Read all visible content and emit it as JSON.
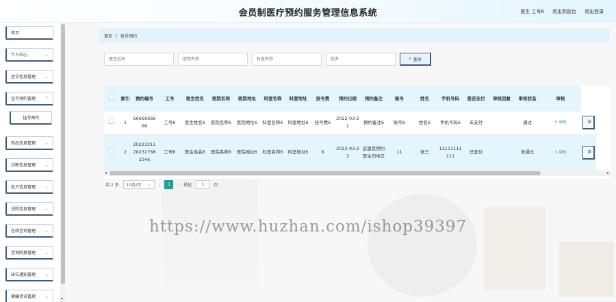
{
  "header": {
    "title": "会员制医疗预约服务管理信息系统",
    "user_label": "医生 工号6",
    "back_front": "退出到前台",
    "logout": "退出登录"
  },
  "sidebar": {
    "items": [
      {
        "label": "首页",
        "has_chevron": false
      },
      {
        "label": "个人中心",
        "has_chevron": true
      },
      {
        "label": "坐诊信息管理",
        "has_chevron": true
      },
      {
        "label": "挂号预约管理",
        "has_chevron": true
      },
      {
        "label": "挂号预约",
        "has_chevron": false
      },
      {
        "label": "药品信息管理",
        "has_chevron": true
      },
      {
        "label": "诊断信息管理",
        "has_chevron": true
      },
      {
        "label": "处方信息管理",
        "has_chevron": true
      },
      {
        "label": "住院信息管理",
        "has_chevron": true
      },
      {
        "label": "在线咨询管理",
        "has_chevron": true
      },
      {
        "label": "咨询回复管理",
        "has_chevron": true
      },
      {
        "label": "床位通知管理",
        "has_chevron": true
      },
      {
        "label": "健康资讯管理",
        "has_chevron": true
      }
    ]
  },
  "breadcrumb": {
    "home": "首页",
    "sep": "/",
    "current": "挂号预约"
  },
  "search": {
    "doctor_name_placeholder": "医生姓名",
    "hospital_name_placeholder": "医院名称",
    "department_name_placeholder": "科室名称",
    "name_placeholder": "姓名",
    "query_label": "查询"
  },
  "table": {
    "headers": [
      "索引",
      "预约编号",
      "工号",
      "医生姓名",
      "医院名称",
      "医院地址",
      "科室名称",
      "科室地址",
      "挂号费",
      "预约日期",
      "预约备注",
      "账号",
      "姓名",
      "手机号码",
      "是否支付",
      "审核回复",
      "审核状态",
      "审核"
    ],
    "rows": [
      {
        "cells": [
          "1",
          "6666666666",
          "工号6",
          "医生姓名6",
          "医院名称6",
          "医院地址6",
          "科室名称6",
          "科室地址6",
          "挂号费6",
          "2022-03-21",
          "预约备注6",
          "账号6",
          "姓名6",
          "手机号码6",
          "未支付",
          "",
          "通过",
          "审核"
        ],
        "action": "详"
      },
      {
        "cells": [
          "2",
          "20223211782327682346",
          "工号6",
          "医生姓名6",
          "医院名称6",
          "医院地址6",
          "科室名称6",
          "科室地址6",
          "6",
          "2022-03-23",
          "这里是预约医生的地方",
          "11",
          "张三",
          "13111111111",
          "已支付",
          "",
          "未通过",
          "审核"
        ],
        "action": "详"
      }
    ]
  },
  "pagination": {
    "total": "共 2 条",
    "page_size": "10条/页",
    "prev": "‹",
    "current_page": "1",
    "next": "›",
    "goto_label": "前往",
    "goto_value": "1",
    "page_unit": "页"
  },
  "watermark": "https://www.huzhan.com/ishop39397",
  "colors": {
    "accent": "#2a9d8f",
    "header_bg": "#e5f5fd",
    "menu_border": "#3f5a7a"
  }
}
